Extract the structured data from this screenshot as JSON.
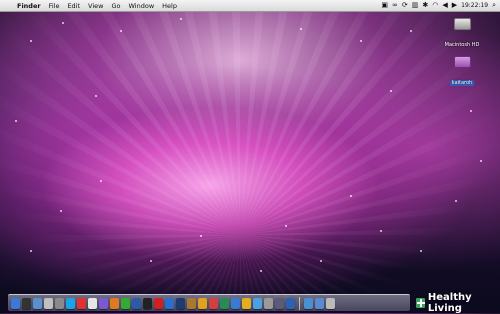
{
  "menubar": {
    "apple": "",
    "menus": [
      "Finder",
      "File",
      "Edit",
      "View",
      "Go",
      "Window",
      "Help"
    ],
    "time": "19:22:19"
  },
  "desktop": {
    "icons": [
      {
        "label": "Macintosh HD",
        "icon": "hard-drive-icon"
      },
      {
        "label": "kaitaroh",
        "icon": "user-folder-icon"
      }
    ]
  },
  "dock": {
    "items": [
      {
        "icon": "finder-icon",
        "color": "#3b78d8"
      },
      {
        "icon": "dashboard-icon",
        "color": "#333333"
      },
      {
        "icon": "itunes-icon",
        "color": "#5a8fd0"
      },
      {
        "icon": "preview-icon",
        "color": "#c0c0c0"
      },
      {
        "icon": "system-preferences-icon",
        "color": "#8a8a8a"
      },
      {
        "icon": "skype-icon",
        "color": "#1aa3e8"
      },
      {
        "icon": "calendar-icon",
        "color": "#d33"
      },
      {
        "icon": "ical-icon",
        "color": "#e6e6e6"
      },
      {
        "icon": "photos-icon",
        "color": "#7a5ad0"
      },
      {
        "icon": "firefox-icon",
        "color": "#e07a20"
      },
      {
        "icon": "spotify-icon",
        "color": "#3a3"
      },
      {
        "icon": "app-icon",
        "color": "#2b5aa8"
      },
      {
        "icon": "terminal-icon",
        "color": "#222"
      },
      {
        "icon": "acrobat-icon",
        "color": "#c22"
      },
      {
        "icon": "editor-icon",
        "color": "#2a6fcf"
      },
      {
        "icon": "photoshop-icon",
        "color": "#1e3a6e"
      },
      {
        "icon": "paw-icon",
        "color": "#aa7733"
      },
      {
        "icon": "chrome-icon",
        "color": "#e0a020"
      },
      {
        "icon": "settings-icon",
        "color": "#d04040"
      },
      {
        "icon": "utility-icon",
        "color": "#2a8a55"
      },
      {
        "icon": "mail-icon",
        "color": "#3a7ad0"
      },
      {
        "icon": "game-icon",
        "color": "#e0b020"
      },
      {
        "icon": "chat-icon",
        "color": "#4aa0e0"
      },
      {
        "icon": "browser-icon",
        "color": "#9a9a9a"
      },
      {
        "icon": "time-machine-icon",
        "color": "#5a5a7a"
      },
      {
        "icon": "network-icon",
        "color": "#3060b0"
      },
      {
        "icon": "downloads-icon",
        "color": "#4a90d0"
      },
      {
        "icon": "folder-icon",
        "color": "#5a8ad0"
      },
      {
        "icon": "trash-icon",
        "color": "#bbbbbb"
      }
    ]
  },
  "watermark": {
    "text": "Healthy Living"
  }
}
